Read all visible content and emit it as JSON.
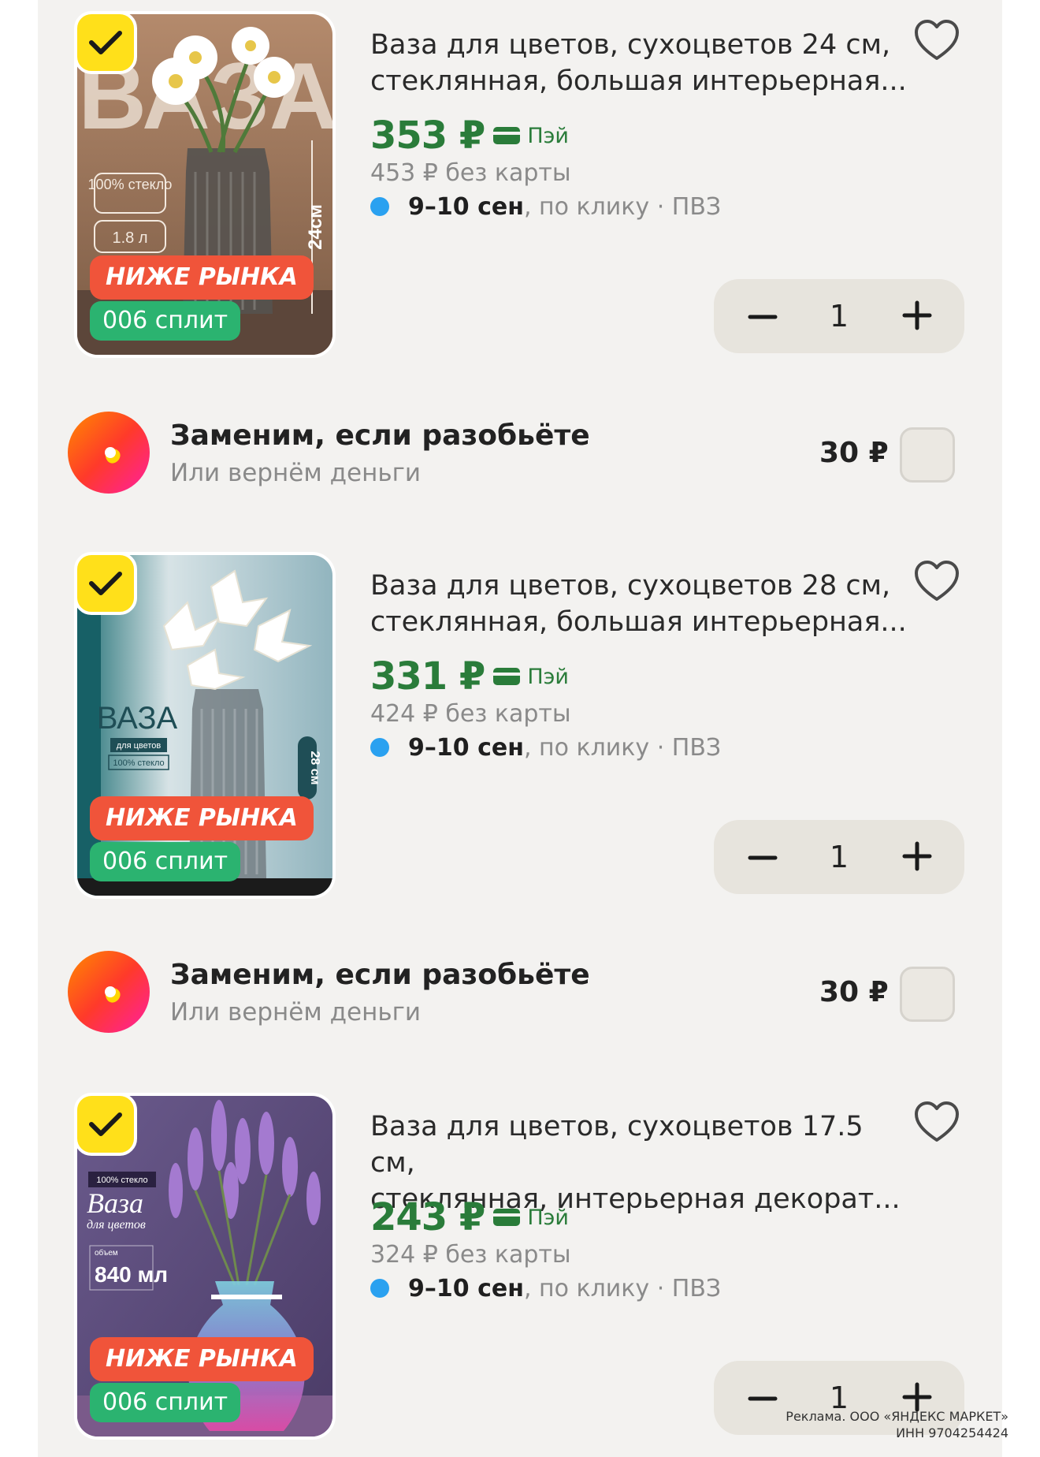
{
  "colors": {
    "price_green": "#2a7c3a",
    "accent_yellow": "#ffe01a",
    "badge_red": "#f0543a",
    "badge_green": "#2bb370",
    "delivery_dot": "#2aa1f0",
    "panel_bg": "#f3f2f0"
  },
  "products": [
    {
      "title": "Ваза для цветов, сухоцветов 24 см,\nстеклянная, большая интерьерная...",
      "price": "353 ₽",
      "pay_label": "Пэй",
      "old_price": "453 ₽  без карты",
      "delivery_date": "9–10 сен",
      "delivery_rest": ", по клику · ПВЗ",
      "badge_market": "НИЖЕ РЫНКА",
      "badge_split": "006 сплит",
      "quantity": "1",
      "image_overlay": [
        "ВАЗА",
        "100% стекло",
        "1.8 л",
        "24см"
      ]
    },
    {
      "title": "Ваза для цветов, сухоцветов 28 см,\nстеклянная, большая интерьерная...",
      "price": "331 ₽",
      "pay_label": "Пэй",
      "old_price": "424 ₽  без карты",
      "delivery_date": "9–10 сен",
      "delivery_rest": ", по клику · ПВЗ",
      "badge_market": "НИЖЕ РЫНКА",
      "badge_split": "006 сплит",
      "quantity": "1",
      "image_overlay": [
        "ВАЗА",
        "для цветов",
        "100% стекло",
        "28 см"
      ]
    },
    {
      "title": "Ваза для цветов, сухоцветов 17.5 см,\nстеклянная, интерьерная декорат...",
      "price": "243 ₽",
      "pay_label": "Пэй",
      "old_price": "324 ₽  без карты",
      "delivery_date": "9–10 сен",
      "delivery_rest": ", по клику · ПВЗ",
      "badge_market": "НИЖЕ РЫНКА",
      "badge_split": "006 сплит",
      "quantity": "1",
      "image_overlay": [
        "100% стекло",
        "Ваза",
        "для цветов",
        "объем",
        "840 мл"
      ]
    }
  ],
  "insurance": [
    {
      "title": "Заменим, если разобьёте",
      "subtitle": "Или вернём деньги",
      "price": "30 ₽"
    },
    {
      "title": "Заменим, если разобьёте",
      "subtitle": "Или вернём деньги",
      "price": "30 ₽"
    }
  ],
  "ad": {
    "line1": "Реклама. ООО «ЯНДЕКС МАРКЕТ»",
    "line2": "ИНН 9704254424"
  },
  "icons": [
    "check-icon",
    "heart-icon",
    "card-icon",
    "minus-icon",
    "plus-icon",
    "insurance-logo-icon"
  ]
}
